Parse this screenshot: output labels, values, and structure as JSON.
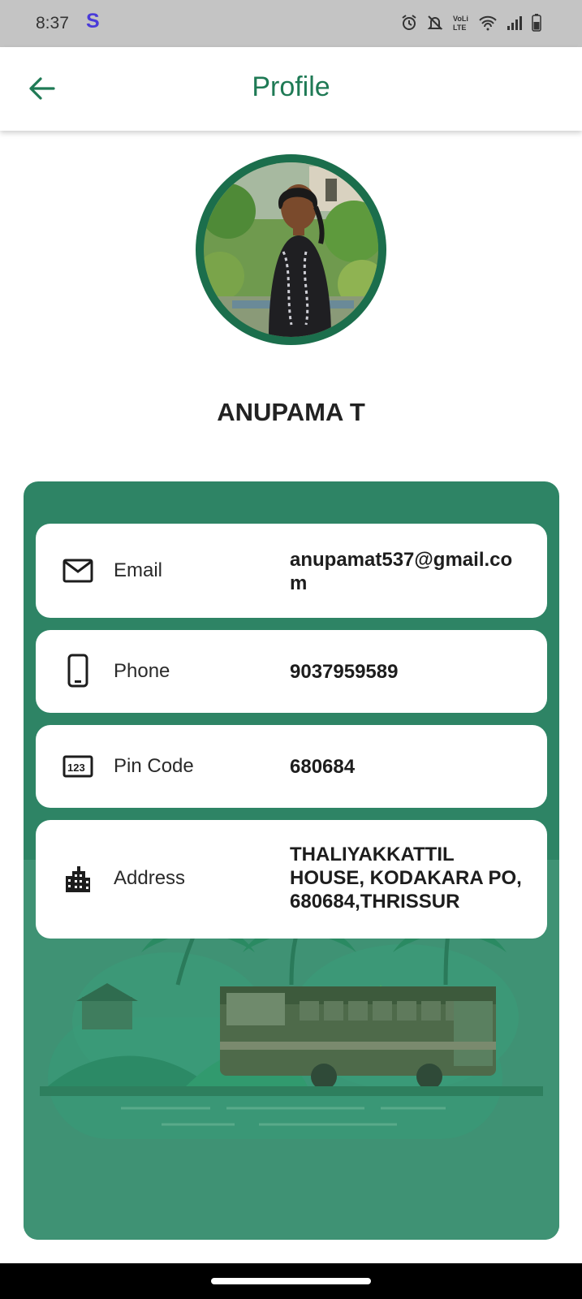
{
  "status_bar": {
    "time": "8:37",
    "app_indicator": "S",
    "icons": [
      "alarm-icon",
      "mute-icon",
      "volte-icon",
      "wifi-icon",
      "signal-icon",
      "battery-icon"
    ]
  },
  "app_bar": {
    "title": "Profile",
    "back_icon": "arrow-left-icon"
  },
  "profile": {
    "name": "ANUPAMA T"
  },
  "details": [
    {
      "icon": "email-icon",
      "label": "Email",
      "value": "anupamat537@gmail.com"
    },
    {
      "icon": "phone-icon",
      "label": "Phone",
      "value": "9037959589"
    },
    {
      "icon": "pin-123-icon",
      "label": "Pin Code",
      "value": "680684"
    },
    {
      "icon": "building-icon",
      "label": "Address",
      "value": "THALIYAKKATTIL HOUSE, KODAKARA PO, 680684,THRISSUR"
    }
  ],
  "colors": {
    "accent": "#1f7a55",
    "card_green": "#2e8465",
    "card_green_light": "#3f9274",
    "status_bar": "#c4c4c4"
  }
}
